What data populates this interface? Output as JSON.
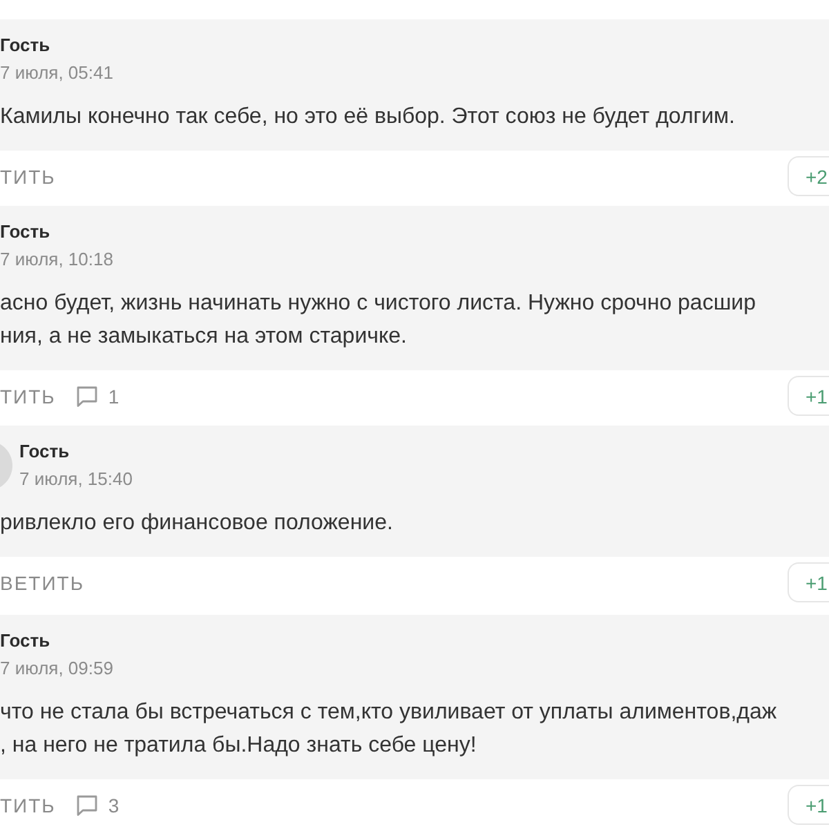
{
  "comments": [
    {
      "author": "Гость",
      "date": "7 июля, 05:41",
      "text": "Камилы конечно так себе, но это её выбор. Этот союз не будет долгим.",
      "reply_label": "ТИТЬ",
      "rating": "+2"
    },
    {
      "author": "Гость",
      "date": "7 июля, 10:18",
      "text": "асно будет, жизнь начинать нужно с чистого листа. Нужно срочно расшир\nния, а не замыкаться на этом старичке.",
      "reply_label": "ТИТЬ",
      "reply_count": "1",
      "rating": "+1",
      "children": [
        {
          "author": "Гость",
          "date": "7 июля, 15:40",
          "text": "ривлекло его финансовое положение.",
          "reply_label": "ВЕТИТЬ",
          "rating": "+1"
        }
      ]
    },
    {
      "author": "Гость",
      "date": "7 июля, 09:59",
      "text": "что не стала бы встречаться с тем,кто увиливает от уплаты алиментов,даж\n, на него не тратила бы.Надо знать себе цену!",
      "reply_label": "ТИТЬ",
      "reply_count": "3",
      "rating": "+1"
    }
  ]
}
